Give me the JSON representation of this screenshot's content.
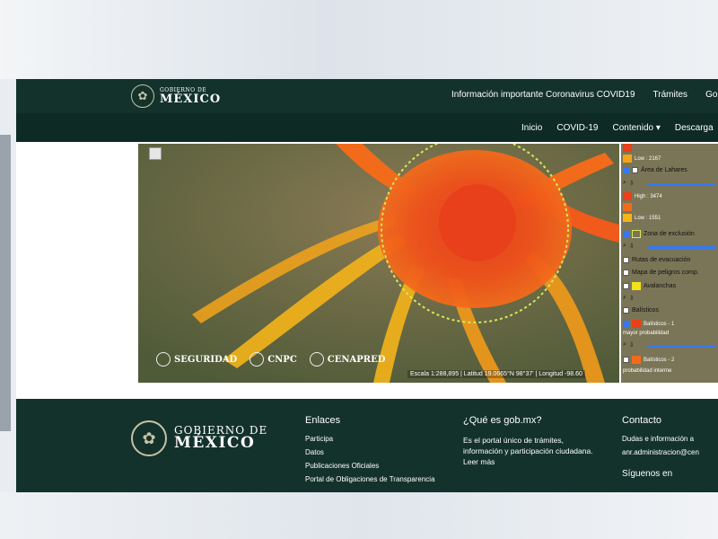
{
  "header": {
    "logo_small": "GOBIERNO DE",
    "logo_big": "MÉXICO",
    "nav": [
      "Información importante Coronavirus COVID19",
      "Trámites",
      "Gobi"
    ]
  },
  "subnav": [
    "Inicio",
    "COVID-19",
    "Contenido ▾",
    "Descarga"
  ],
  "map": {
    "agencies": [
      "SEGURIDAD",
      "CNPC",
      "CENAPRED"
    ],
    "scale_text": "Escala 1:288,895 | Latitud 19.0665°N 98°37' | Longitud -98.60"
  },
  "legend": {
    "rows": [
      {
        "label": "Low : 2167"
      },
      {
        "label": "Área de Lahares"
      },
      {
        "label": "High : 3474"
      },
      {
        "label": "Low : 1551"
      },
      {
        "label": "Zona de exclusión"
      },
      {
        "label": "Rutas de evacuación"
      },
      {
        "label": "Mapa de peligros comp."
      },
      {
        "label": "Avalanchas"
      },
      {
        "label": "Balísticos"
      },
      {
        "label": "Balísticos - 1"
      },
      {
        "label": "mayor probabilidad"
      },
      {
        "label": "Balísticos - 2"
      },
      {
        "label": "probabilidad interme"
      }
    ]
  },
  "footer": {
    "logo_small": "GOBIERNO DE",
    "logo_big": "MÉXICO",
    "col1_title": "Enlaces",
    "col1_items": [
      "Participa",
      "Datos",
      "Publicaciones Oficiales",
      "Portal de Obligaciones de Transparencia"
    ],
    "col2_title": "¿Qué es gob.mx?",
    "col2_text": "Es el portal único de trámites, información y participación ciudadana. Leer más",
    "col3_title": "Contacto",
    "col3_text": "Dudas e información a",
    "col3_email": "anr.administracion@cen",
    "col3_follow": "Síguenos en"
  },
  "colors": {
    "header_green": "#13322b",
    "subbar_green": "#0d2a24",
    "lava_red": "#e8401a",
    "lava_orange": "#f26b1b",
    "lava_yellow": "#f4b41a",
    "exclusion_ring": "#d8e85a"
  }
}
